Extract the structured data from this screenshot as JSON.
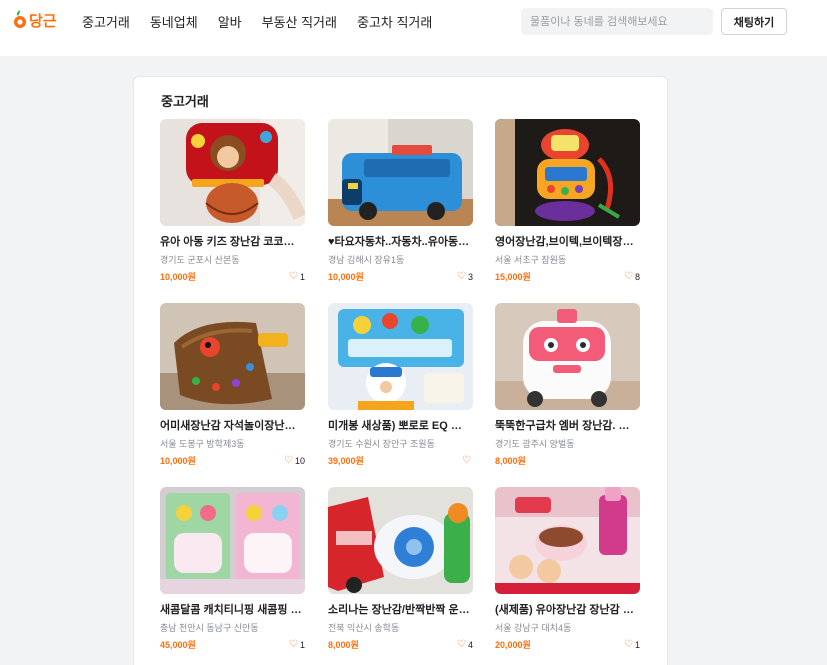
{
  "header": {
    "logo_text": "당근",
    "nav": [
      "중고거래",
      "동네업체",
      "알바",
      "부동산 직거래",
      "중고차 직거래"
    ],
    "search_placeholder": "물품이나 동네를 검색해보세요",
    "chat_button": "채팅하기"
  },
  "main": {
    "section_title": "중고거래",
    "items": [
      {
        "title": "유아 아동 키즈 장난감 코코몽 농구대",
        "location": "경기도 군포시 산본동",
        "price": "10,000원",
        "likes": "1"
      },
      {
        "title": "♥타요자동차..자동차..유아동 장난감",
        "location": "경남 김해시 장유1동",
        "price": "10,000원",
        "likes": "3"
      },
      {
        "title": "영어장난감,브이텍,브이텍장난감",
        "location": "서울 서초구 잠원동",
        "price": "15,000원",
        "likes": "8"
      },
      {
        "title": "어미새장난감 자석놀이장난감 딱따구리",
        "location": "서울 도봉구 방학제3동",
        "price": "10,000원",
        "likes": "10"
      },
      {
        "title": "미개봉 새상품) 뽀로로 EQ 테이블",
        "location": "경기도 수원시 장안구 조원동",
        "price": "39,000원",
        "likes": ""
      },
      {
        "title": "뚝뚝한구급차 엠버 장난감. 로보카폴리",
        "location": "경기도 광주시 양벌동",
        "price": "8,000원",
        "likes": ""
      },
      {
        "title": "새콤달콤 캐치티니핑 새콤핑 장난감",
        "location": "충남 천안시 동남구 신안동",
        "price": "45,000원",
        "likes": "1"
      },
      {
        "title": "소리나는 장난감/반짝반짝 운전대 장난감",
        "location": "전북 익산시 송학동",
        "price": "8,000원",
        "likes": "4"
      },
      {
        "title": "(새제품) 유아장난감 장난감 케이크",
        "location": "서울 강남구 대치4동",
        "price": "20,000원",
        "likes": "1"
      }
    ]
  },
  "colors": {
    "accent": "#ff6f0f",
    "text": "#212124",
    "muted": "#868b94"
  },
  "icons": [
    "carrot-logo-icon",
    "heart-icon"
  ]
}
